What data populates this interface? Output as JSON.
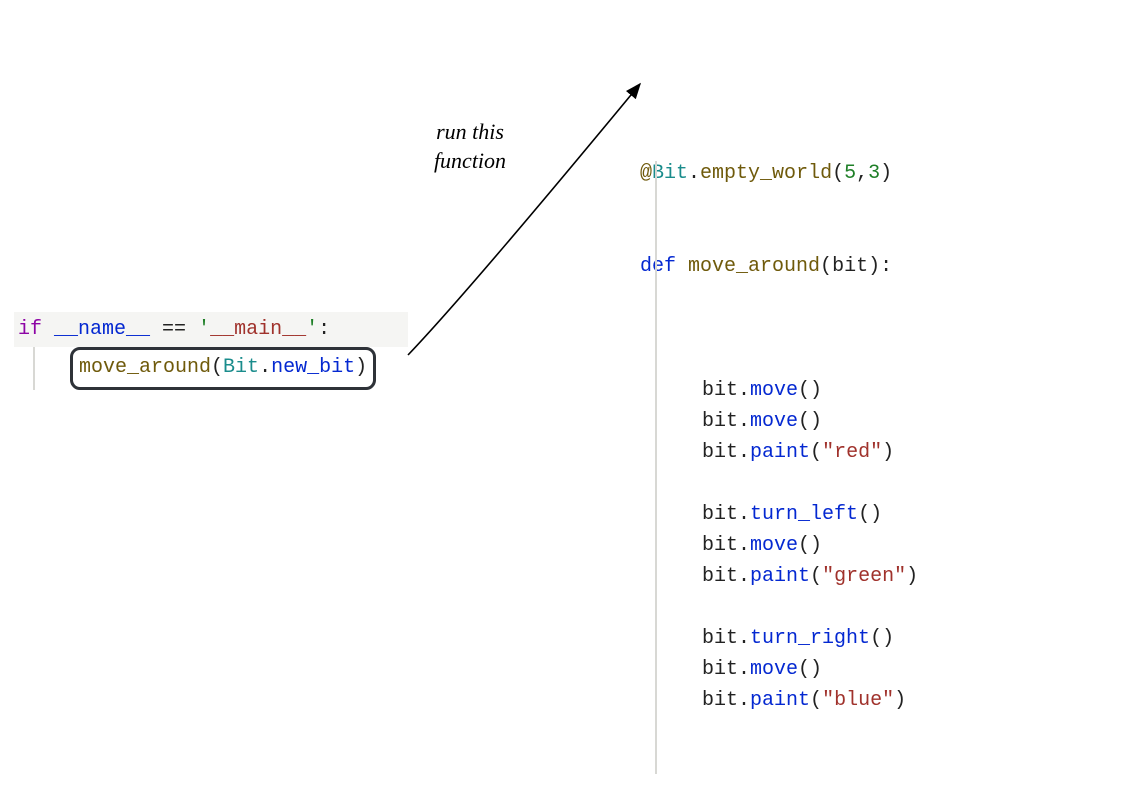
{
  "annotation": {
    "line1": "run this",
    "line2": "function"
  },
  "left": {
    "kw_if": "if ",
    "dunder_name": "__name__",
    "eq": " == ",
    "q1": "'",
    "main_str": "__main__",
    "q2": "'",
    "colon": ":",
    "call_name": "move_around",
    "lp": "(",
    "cls": "Bit",
    "dot": ".",
    "attr": "new_bit",
    "rp": ")"
  },
  "right": {
    "at": "@",
    "cls": "Bit",
    "dot1": ".",
    "deco": "empty_world",
    "lp1": "(",
    "arg1": "5",
    "comma": ",",
    "arg2": "3",
    "rp1": ")",
    "kw_def": "def ",
    "fname": "move_around",
    "lp2": "(",
    "param": "bit",
    "rp2": ")",
    "colon": ":",
    "body": [
      [
        {
          "t": "bit",
          "c": "plain"
        },
        {
          "t": ".",
          "c": "plain"
        },
        {
          "t": "move",
          "c": "id"
        },
        {
          "t": "()",
          "c": "plain"
        }
      ],
      [
        {
          "t": "bit",
          "c": "plain"
        },
        {
          "t": ".",
          "c": "plain"
        },
        {
          "t": "move",
          "c": "id"
        },
        {
          "t": "()",
          "c": "plain"
        }
      ],
      [
        {
          "t": "bit",
          "c": "plain"
        },
        {
          "t": ".",
          "c": "plain"
        },
        {
          "t": "paint",
          "c": "id"
        },
        {
          "t": "(",
          "c": "plain"
        },
        {
          "t": "\"red\"",
          "c": "strred"
        },
        {
          "t": ")",
          "c": "plain"
        }
      ],
      [],
      [
        {
          "t": "bit",
          "c": "plain"
        },
        {
          "t": ".",
          "c": "plain"
        },
        {
          "t": "turn_left",
          "c": "id"
        },
        {
          "t": "()",
          "c": "plain"
        }
      ],
      [
        {
          "t": "bit",
          "c": "plain"
        },
        {
          "t": ".",
          "c": "plain"
        },
        {
          "t": "move",
          "c": "id"
        },
        {
          "t": "()",
          "c": "plain"
        }
      ],
      [
        {
          "t": "bit",
          "c": "plain"
        },
        {
          "t": ".",
          "c": "plain"
        },
        {
          "t": "paint",
          "c": "id"
        },
        {
          "t": "(",
          "c": "plain"
        },
        {
          "t": "\"green\"",
          "c": "strred"
        },
        {
          "t": ")",
          "c": "plain"
        }
      ],
      [],
      [
        {
          "t": "bit",
          "c": "plain"
        },
        {
          "t": ".",
          "c": "plain"
        },
        {
          "t": "turn_right",
          "c": "id"
        },
        {
          "t": "()",
          "c": "plain"
        }
      ],
      [
        {
          "t": "bit",
          "c": "plain"
        },
        {
          "t": ".",
          "c": "plain"
        },
        {
          "t": "move",
          "c": "id"
        },
        {
          "t": "()",
          "c": "plain"
        }
      ],
      [
        {
          "t": "bit",
          "c": "plain"
        },
        {
          "t": ".",
          "c": "plain"
        },
        {
          "t": "paint",
          "c": "id"
        },
        {
          "t": "(",
          "c": "plain"
        },
        {
          "t": "\"blue\"",
          "c": "strred"
        },
        {
          "t": ")",
          "c": "plain"
        }
      ]
    ]
  }
}
